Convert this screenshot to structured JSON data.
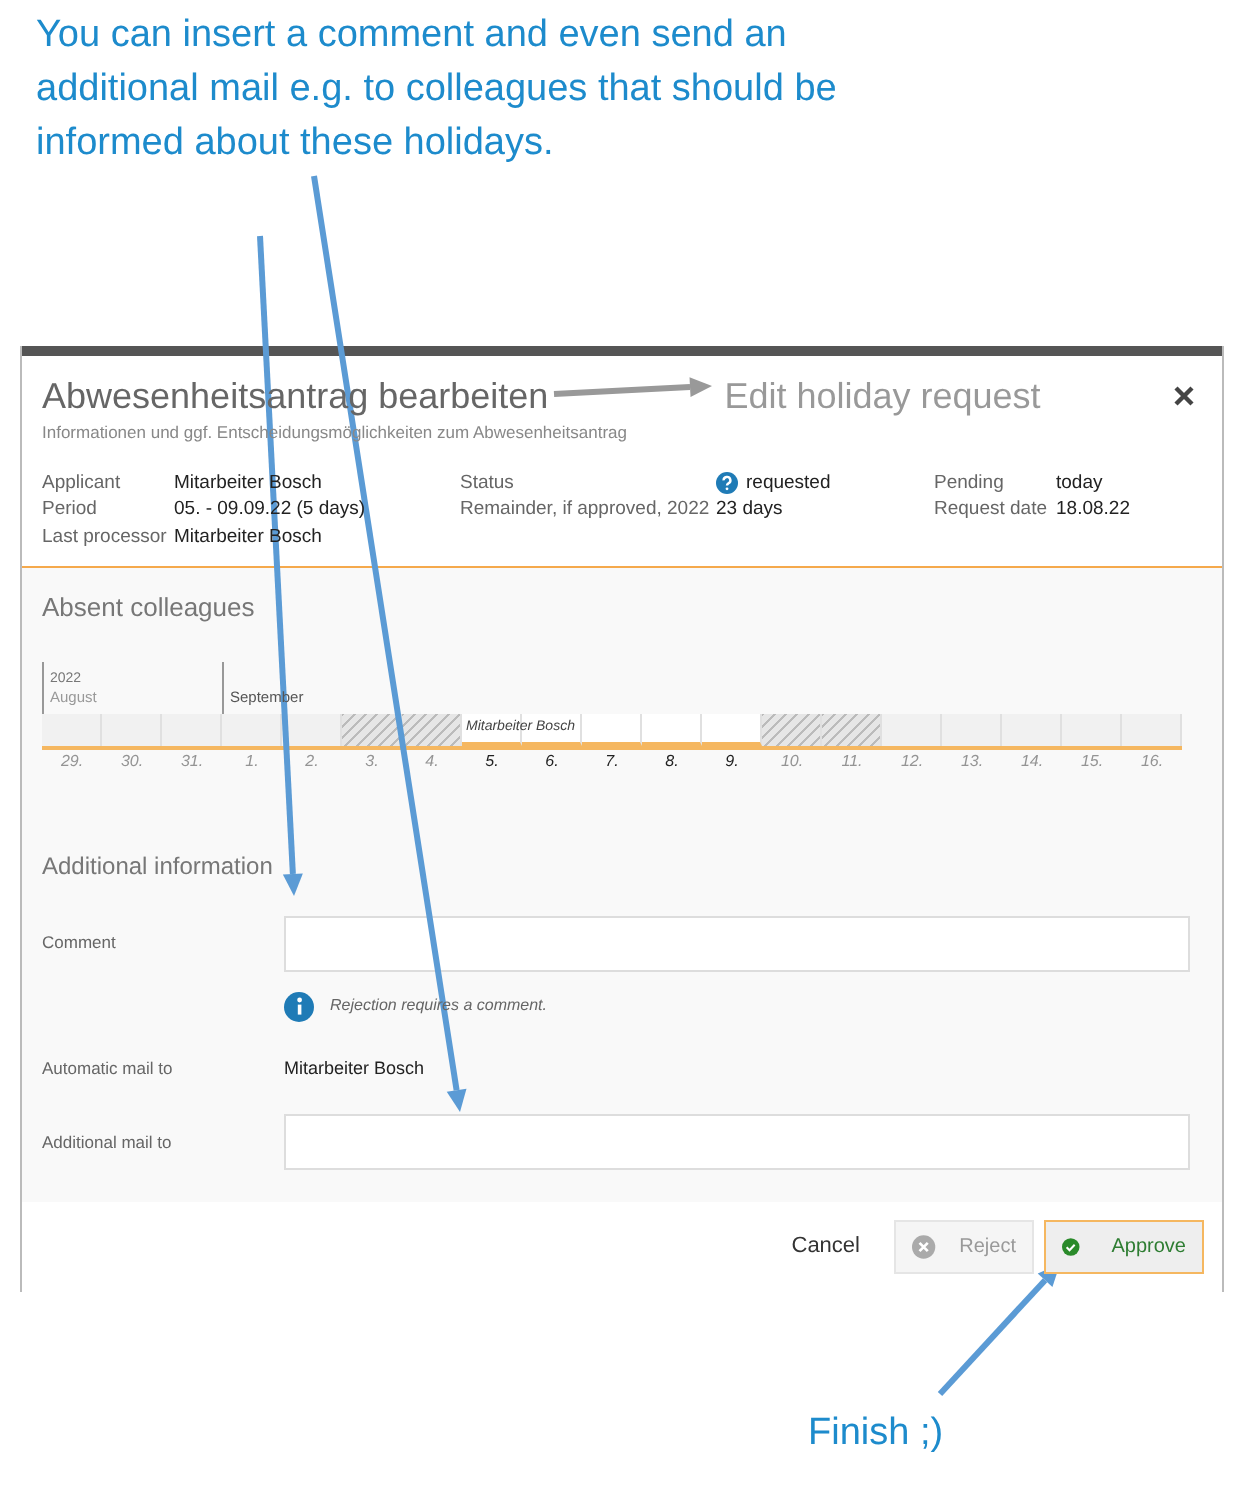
{
  "callout_top": "You can insert a comment and even send an additional mail e.g. to colleagues that should be informed about these holidays.",
  "dialog": {
    "title": "Abwesenheitsantrag bearbeiten",
    "title_note": "Edit holiday request",
    "subtitle": "Informationen und ggf. Entscheidungsmöglichkeiten zum Abwesenheitsantrag",
    "detail_columns": [
      [
        {
          "label": "Applicant",
          "value": "Mitarbeiter Bosch"
        },
        {
          "label": "Period",
          "value": "05. - 09.09.22 (5 days)"
        },
        {
          "label": "Last processor",
          "value": "Mitarbeiter Bosch"
        }
      ],
      [
        {
          "label": "Status",
          "value": "requested",
          "kind": "status"
        },
        {
          "label": "Remainder, if approved, 2022",
          "value": "23 days"
        }
      ],
      [
        {
          "label": "Pending",
          "value": "today"
        },
        {
          "label": "Request date",
          "value": "18.08.22"
        }
      ]
    ]
  },
  "absent": {
    "heading": "Absent colleagues",
    "year": "2022",
    "person": "Mitarbeiter Bosch",
    "months": [
      {
        "label": "August",
        "dimmed": true,
        "days": [
          {
            "label": "29.",
            "weekend": false,
            "absent": false
          },
          {
            "label": "30.",
            "weekend": false,
            "absent": false
          },
          {
            "label": "31.",
            "weekend": false,
            "absent": false
          }
        ]
      },
      {
        "label": "September",
        "dimmed": false,
        "days": [
          {
            "label": "1.",
            "weekend": false,
            "absent": false
          },
          {
            "label": "2.",
            "weekend": false,
            "absent": false
          },
          {
            "label": "3.",
            "weekend": true,
            "absent": false
          },
          {
            "label": "4.",
            "weekend": true,
            "absent": false
          },
          {
            "label": "5.",
            "weekend": false,
            "absent": true
          },
          {
            "label": "6.",
            "weekend": false,
            "absent": true
          },
          {
            "label": "7.",
            "weekend": false,
            "absent": true
          },
          {
            "label": "8.",
            "weekend": false,
            "absent": true
          },
          {
            "label": "9.",
            "weekend": false,
            "absent": true
          },
          {
            "label": "10.",
            "weekend": true,
            "absent": false
          },
          {
            "label": "11.",
            "weekend": true,
            "absent": false
          },
          {
            "label": "12.",
            "weekend": false,
            "absent": false
          },
          {
            "label": "13.",
            "weekend": false,
            "absent": false
          },
          {
            "label": "14.",
            "weekend": false,
            "absent": false
          },
          {
            "label": "15.",
            "weekend": false,
            "absent": false
          },
          {
            "label": "16.",
            "weekend": false,
            "absent": false
          }
        ]
      }
    ]
  },
  "additional": {
    "heading": "Additional information",
    "comment_label": "Comment",
    "hint": "Rejection requires a comment.",
    "auto_mail_label": "Automatic mail to",
    "auto_mail_value": "Mitarbeiter Bosch",
    "extra_mail_label": "Additional mail to"
  },
  "buttons": [
    {
      "label": "Cancel",
      "kind": "link"
    },
    {
      "label": "Reject",
      "kind": "reject",
      "disabled": true
    },
    {
      "label": "Approve",
      "kind": "approve",
      "disabled": false
    }
  ],
  "callout_bottom": "Finish ;)"
}
